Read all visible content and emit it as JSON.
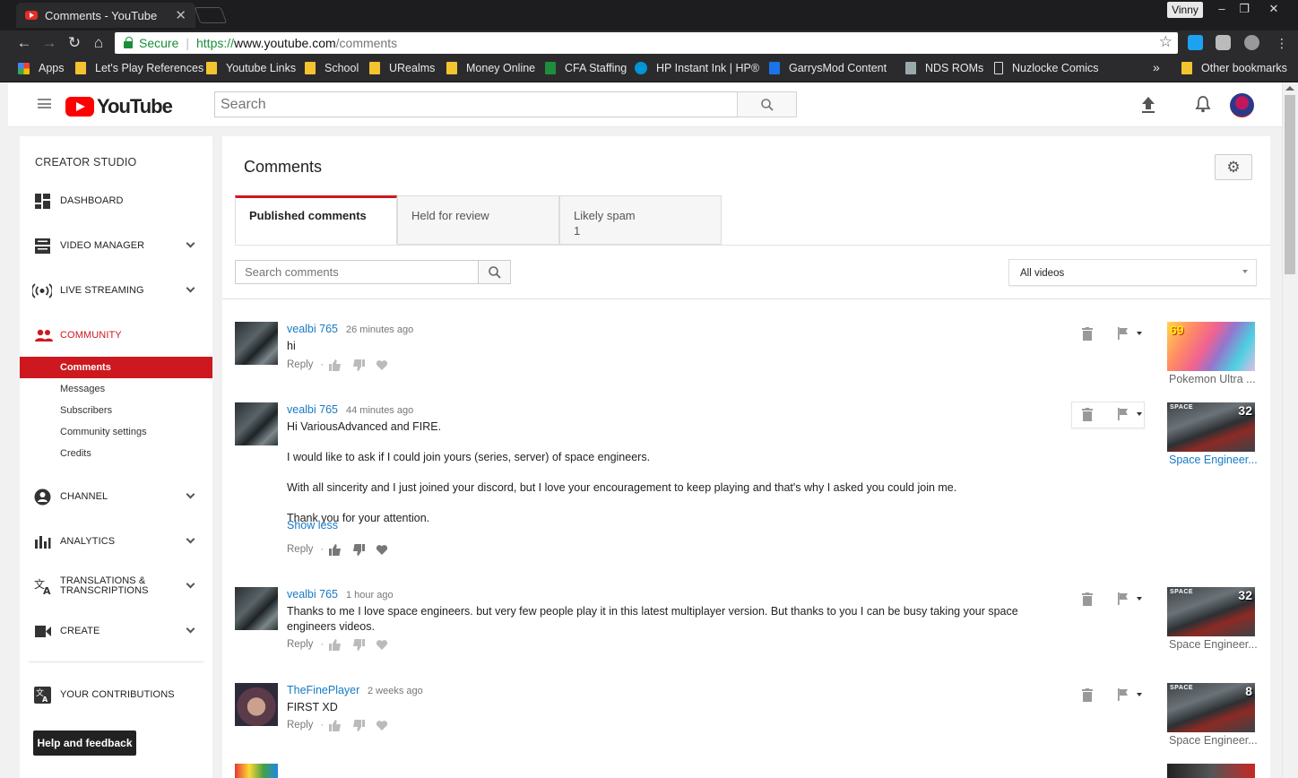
{
  "browser": {
    "tab_title": "Comments - YouTube",
    "tab_close": "✕",
    "profile_name": "Vinny",
    "window_controls": {
      "minimize": "–",
      "restore": "❐",
      "close": "✕"
    },
    "secure_label": "Secure",
    "url": {
      "protocol": "https://",
      "host": "www.youtube.com",
      "path": "/comments"
    },
    "bookmarks": [
      "Apps",
      "Let's Play References",
      "Youtube Links",
      "School",
      "URealms",
      "Money Online",
      "CFA Staffing",
      "HP Instant Ink | HP®",
      "GarrysMod Content A",
      "NDS ROMs",
      "Nuzlocke Comics"
    ],
    "bookmarks_overflow": "»",
    "other_bookmarks": "Other bookmarks",
    "icons": {
      "back": "back-arrow-icon",
      "forward": "forward-arrow-icon",
      "reload": "reload-icon",
      "home": "home-icon",
      "star": "bookmark-star-icon"
    }
  },
  "youtube": {
    "logo_text": "YouTube",
    "search_placeholder": "Search",
    "sidebar": {
      "title": "CREATOR STUDIO",
      "items": [
        {
          "label": "DASHBOARD",
          "icon": "dashboard-icon"
        },
        {
          "label": "VIDEO MANAGER",
          "icon": "video-manager-icon"
        },
        {
          "label": "LIVE STREAMING",
          "icon": "live-streaming-icon"
        },
        {
          "label": "COMMUNITY",
          "icon": "community-icon"
        },
        {
          "label": "CHANNEL",
          "icon": "channel-icon"
        },
        {
          "label": "ANALYTICS",
          "icon": "analytics-icon"
        },
        {
          "label": "TRANSLATIONS &",
          "label2": "TRANSCRIPTIONS",
          "icon": "translations-icon"
        },
        {
          "label": "CREATE",
          "icon": "create-icon"
        },
        {
          "label": "YOUR CONTRIBUTIONS",
          "icon": "contributions-icon"
        }
      ],
      "community_sub": [
        "Comments",
        "Messages",
        "Subscribers",
        "Community settings",
        "Credits"
      ],
      "help_button": "Help and feedback",
      "accent_color": "#cc181e"
    },
    "main": {
      "title": "Comments",
      "tabs": [
        {
          "label": "Published comments",
          "count": ""
        },
        {
          "label": "Held for review",
          "count": ""
        },
        {
          "label": "Likely spam",
          "count": "1"
        }
      ],
      "comment_search_placeholder": "Search comments",
      "video_filter": "All videos",
      "reply_label": "Reply",
      "dot": "·",
      "comments": [
        {
          "author": "vealbi 765",
          "time": "26 minutes ago",
          "text": [
            "hi"
          ],
          "video_title": "Pokemon Ultra ...",
          "thumb_badge": "69",
          "thumb_tag": ""
        },
        {
          "author": "vealbi 765",
          "time": "44 minutes ago",
          "text": [
            "Hi VariousAdvanced and FIRE.",
            "I would like to ask if I could join yours (series, server) of space engineers.",
            "With all sincerity and I just joined your discord, but I love your encouragement to keep playing and that's why I asked you could join me.",
            "Thank you for your attention."
          ],
          "show_less": "Show less",
          "video_title": "Space Engineer...",
          "thumb_badge": "32",
          "thumb_tag": "SPACE"
        },
        {
          "author": "vealbi 765",
          "time": "1 hour ago",
          "text": [
            "Thanks to me I love space engineers. but very few people play it in this latest multiplayer version. But thanks to you I can be busy taking your space engineers videos."
          ],
          "video_title": "Space Engineer...",
          "thumb_badge": "32",
          "thumb_tag": "SPACE"
        },
        {
          "author": "TheFinePlayer",
          "time": "2 weeks ago",
          "text": [
            "FIRST XD"
          ],
          "video_title": "Space Engineer...",
          "thumb_badge": "8",
          "thumb_tag": "SPACE"
        }
      ]
    }
  }
}
